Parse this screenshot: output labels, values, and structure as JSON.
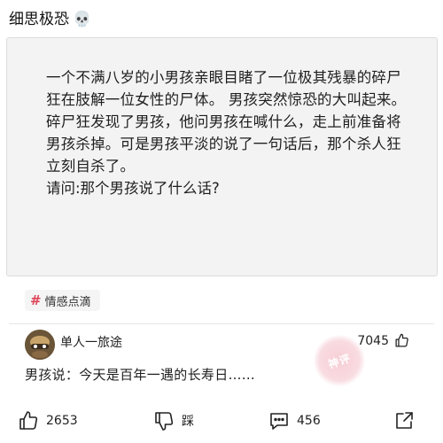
{
  "post": {
    "title": "细思极恐",
    "title_emoji": "skull-emoji"
  },
  "question": {
    "body": "一个不满八岁的小男孩亲眼目睹了一位极其残暴的碎尸狂在肢解一位女性的尸体。 男孩突然惊恐的大叫起来。碎尸狂发现了男孩，他问男孩在喊什么，走上前准备将男孩杀掉。可是男孩平淡的说了一句话后，那个杀人狂立刻自杀了。",
    "ask": "请问:那个男孩说了什么话?"
  },
  "tag": {
    "icon": "hash-icon",
    "label": "情感点滴"
  },
  "comment": {
    "user": "单人一旅途",
    "likes": "7045",
    "text": "男孩说：今天是百年一遇的长寿日……",
    "stamp_text": "神评"
  },
  "actions": {
    "like_count": "2653",
    "dislike_label": "踩",
    "comment_count": "456"
  },
  "colors": {
    "tag_hash": "#e0455a",
    "card_bg": "#f3f3f3",
    "stamp": "#f4b3c0"
  }
}
